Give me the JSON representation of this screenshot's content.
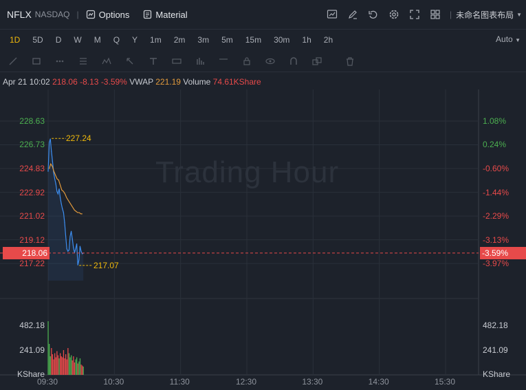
{
  "header": {
    "symbol": "NFLX",
    "exchange": "NASDAQ",
    "options_label": "Options",
    "material_label": "Material",
    "layout_label": "未命名图表布局",
    "icons": [
      "chart-icon",
      "edit-icon",
      "undo-icon",
      "settings-icon",
      "fullscreen-icon",
      "grid-icon"
    ]
  },
  "intervals": [
    "1D",
    "5D",
    "D",
    "W",
    "M",
    "Q",
    "Y",
    "1m",
    "2m",
    "3m",
    "5m",
    "15m",
    "30m",
    "1h",
    "2h"
  ],
  "active_interval": "1D",
  "auto_label": "Auto",
  "info": {
    "datetime": "Apr 21 10:02",
    "price": "218.06",
    "change": "-8.13",
    "change_pct": "-3.59%",
    "vwap_label": "VWAP",
    "vwap": "221.19",
    "volume_label": "Volume",
    "volume": "74.61KShare"
  },
  "watermark": "Trading Hour",
  "left_axis": [
    "228.63",
    "226.73",
    "224.83",
    "222.92",
    "221.02",
    "219.12",
    "217.22"
  ],
  "right_axis": [
    "1.08%",
    "0.24%",
    "-0.60%",
    "-1.44%",
    "-2.29%",
    "-3.13%",
    "-3.97%"
  ],
  "current_price_tag": "218.06",
  "current_pct_tag": "-3.59%",
  "high_label": "227.24",
  "low_label": "217.07",
  "volume_axis": [
    "482.18",
    "241.09"
  ],
  "volume_unit": "KShare",
  "x_axis": [
    "09:30",
    "10:30",
    "11:30",
    "12:30",
    "13:30",
    "14:30",
    "15:30"
  ],
  "colors": {
    "up": "#4caf50",
    "down": "#e74a4a",
    "accent": "#f0b90b",
    "price_line": "#3d8ef0",
    "vwap_line": "#e29a3c"
  },
  "chart_data": {
    "type": "line",
    "x": [
      "09:30",
      "09:31",
      "09:32",
      "09:33",
      "09:34",
      "09:35",
      "09:36",
      "09:37",
      "09:38",
      "09:39",
      "09:40",
      "09:41",
      "09:42",
      "09:43",
      "09:44",
      "09:45",
      "09:46",
      "09:47",
      "09:48",
      "09:49",
      "09:50",
      "09:51",
      "09:52",
      "09:53",
      "09:54",
      "09:55",
      "09:56",
      "09:57",
      "09:58",
      "09:59",
      "10:00",
      "10:01",
      "10:02"
    ],
    "series": [
      {
        "name": "VWAP",
        "values": [
          224.8,
          225.2,
          225.0,
          224.6,
          224.3,
          224.0,
          223.9,
          223.5,
          223.1,
          223.0,
          222.8,
          222.5,
          222.3,
          222.1,
          221.9,
          221.7,
          221.5,
          221.4,
          221.3,
          221.3,
          221.2,
          221.2
        ]
      },
      {
        "name": "Price",
        "values": [
          224.6,
          226.9,
          227.2,
          226.2,
          225.4,
          224.5,
          224.0,
          223.6,
          223.0,
          222.8,
          223.2,
          222.5,
          222.0,
          221.6,
          221.3,
          220.5,
          219.4,
          218.4,
          218.2,
          218.3,
          219.4,
          219.8,
          219.2,
          218.5,
          218.1,
          218.4,
          218.8,
          217.1,
          217.5,
          218.6,
          218.2,
          218.0,
          218.06
        ]
      },
      {
        "name": "Volume",
        "values": [
          520,
          300,
          180,
          260,
          200,
          150,
          210,
          170,
          230,
          190,
          160,
          210,
          180,
          170,
          240,
          160,
          200,
          150,
          260,
          210,
          170,
          190,
          140,
          180,
          120,
          150,
          170,
          110,
          130,
          160,
          100,
          90,
          80
        ]
      }
    ],
    "ylim": [
      216.4,
      229.4
    ],
    "high": 227.24,
    "low": 217.07
  }
}
